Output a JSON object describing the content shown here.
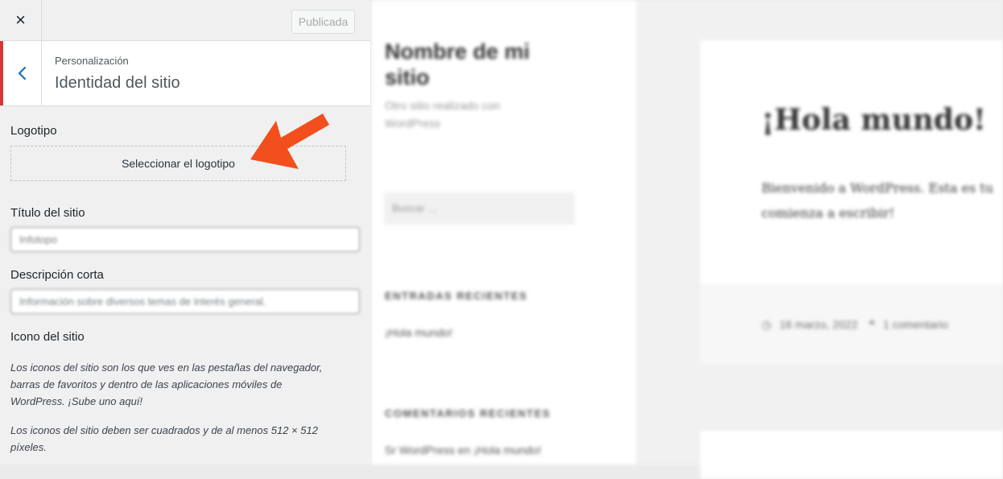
{
  "header": {
    "close_icon": "×",
    "publish_label": "Publicada"
  },
  "section": {
    "breadcrumb": "Personalización",
    "title": "Identidad del sitio"
  },
  "controls": {
    "logo": {
      "label": "Logotipo",
      "button_label": "Seleccionar el logotipo"
    },
    "site_title": {
      "label": "Título del sitio",
      "value": "Infotopo"
    },
    "tagline": {
      "label": "Descripción corta",
      "value": "Información sobre diversos temas de interés general."
    },
    "site_icon": {
      "label": "Icono del sitio",
      "help1": "Los iconos del sitio son los que ves en las pestañas del navegador, barras de favoritos y dentro de las aplicaciones móviles de WordPress. ¡Sube uno aquí!",
      "help2": "Los iconos del sitio deben ser cuadrados y de al menos 512 × 512 píxeles."
    }
  },
  "preview": {
    "site_name": "Nombre de mi sitio",
    "site_description": "Otro sitio realizado con WordPress",
    "search_placeholder": "Buscar …",
    "recent_posts_title": "ENTRADAS RECIENTES",
    "recent_post_1": "¡Hola mundo!",
    "recent_comments_title": "COMENTARIOS RECIENTES",
    "recent_comment_1": "Sr WordPress en ¡Hola mundo!",
    "post_title": "¡Hola mundo!",
    "post_body_line1": "Bienvenido a WordPress. Esta es tu",
    "post_body_line2": "comienza a escribir!",
    "post_date": "16 marzo, 2022",
    "post_comments": "1 comentario"
  },
  "colors": {
    "accent_bar": "#d63638",
    "arrow": "#f24f1d",
    "back_chevron": "#2271b1"
  }
}
